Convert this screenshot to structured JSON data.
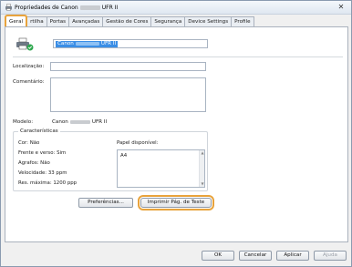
{
  "window": {
    "title_prefix": "Propriedades de Canon",
    "title_suffix": "UFR II",
    "close_glyph": "✕"
  },
  "tabs": [
    {
      "label": "Geral"
    },
    {
      "label": "rtilha"
    },
    {
      "label": "Portas"
    },
    {
      "label": "Avançadas"
    },
    {
      "label": "Gestão de Cores"
    },
    {
      "label": "Segurança"
    },
    {
      "label": "Device Settings"
    },
    {
      "label": "Profile"
    }
  ],
  "general": {
    "printer_name_prefix": "Canon",
    "printer_name_suffix": "UFR II",
    "location_label": "Localização:",
    "location_value": "",
    "comment_label": "Comentário:",
    "comment_value": "",
    "model_label": "Modelo:",
    "model_prefix": "Canon",
    "model_suffix": "UFR II"
  },
  "features": {
    "legend": "Características",
    "color": "Cor: Não",
    "duplex": "Frente e verso: Sim",
    "staple": "Agrafos: Não",
    "speed": "Velocidade: 33 ppm",
    "resolution": "Res. máxima: 1200 ppp",
    "paper_label": "Papel disponível:",
    "paper_items": [
      "A4"
    ]
  },
  "buttons": {
    "preferences": "Preferências...",
    "print_test": "Imprimir Pág. de Teste",
    "ok": "OK",
    "cancel": "Cancelar",
    "apply": "Aplicar",
    "help": "Ajuda"
  },
  "colors": {
    "highlight": "#e8a33c",
    "selection": "#3a8ee6"
  }
}
